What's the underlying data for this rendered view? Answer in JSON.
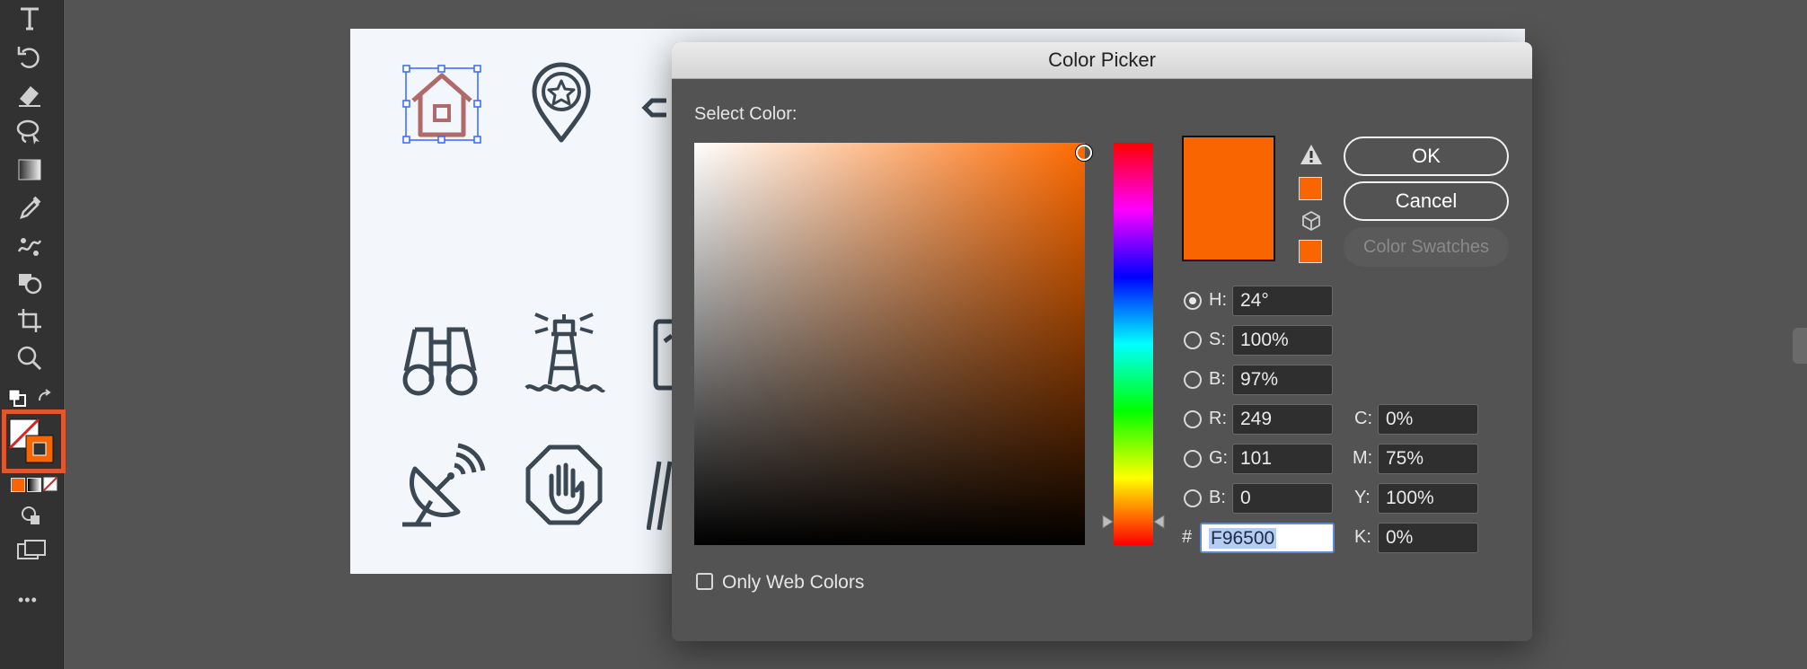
{
  "dialog": {
    "title": "Color Picker",
    "select_color_label": "Select Color:",
    "only_web_colors_label": "Only Web Colors",
    "ok_label": "OK",
    "cancel_label": "Cancel",
    "color_swatches_label": "Color Swatches"
  },
  "hsb": {
    "h_label": "H:",
    "h_value": "24°",
    "s_label": "S:",
    "s_value": "100%",
    "b_label": "B:",
    "b_value": "97%"
  },
  "rgb": {
    "r_label": "R:",
    "r_value": "249",
    "g_label": "G:",
    "g_value": "101",
    "b_label": "B:",
    "b_value": "0"
  },
  "cmyk": {
    "c_label": "C:",
    "c_value": "0%",
    "m_label": "M:",
    "m_value": "75%",
    "y_label": "Y:",
    "y_value": "100%",
    "k_label": "K:",
    "k_value": "0%"
  },
  "hex": {
    "label": "#",
    "value": "F96500"
  },
  "colors": {
    "selected": "#F96500",
    "hue_base": "#FF6A00",
    "highlight": "#E0572F",
    "icon_stroke": "#3b4752"
  },
  "toolbar": {
    "tools": [
      "type-tool-icon",
      "rotate-tool-icon",
      "eraser-tool-icon",
      "lasso-tool-icon",
      "gradient-tool-icon",
      "eyedropper-tool-icon",
      "puppet-warp-tool-icon",
      "shape-builder-tool-icon",
      "artboard-tool-icon",
      "zoom-tool-icon"
    ],
    "more_label": "•••"
  }
}
